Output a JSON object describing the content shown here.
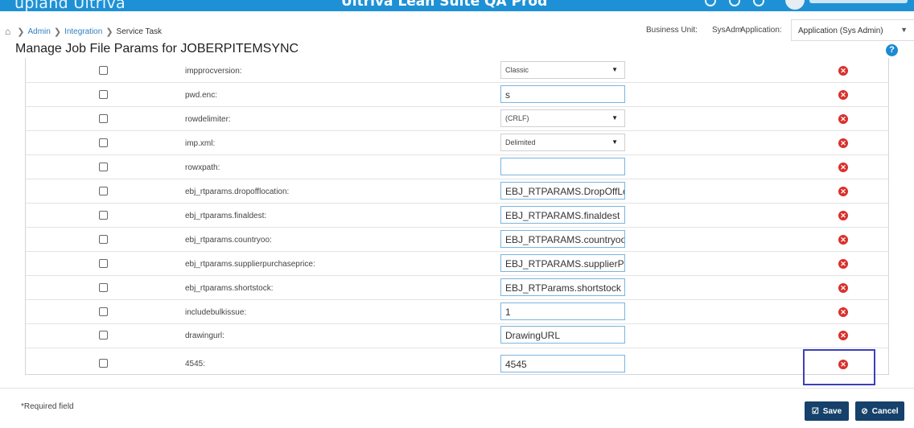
{
  "topbar": {
    "brand": "upland Ultriva",
    "suite": "Ultriva Lean Suite QA Prod"
  },
  "breadcrumb": {
    "items": [
      "Admin",
      "Integration"
    ],
    "current": "Service Task"
  },
  "context": {
    "business_unit_label": "Business Unit:",
    "business_unit_value": "SysAdm",
    "application_label": "Application:",
    "application_value": "Application (Sys Admin)"
  },
  "page": {
    "title": "Manage Job File Params for JOBERPITEMSYNC",
    "help_label": "?"
  },
  "params": [
    {
      "name": "impprocversion:",
      "type": "select",
      "value": "Classic"
    },
    {
      "name": "pwd.enc:",
      "type": "text",
      "value": "s"
    },
    {
      "name": "rowdelimiter:",
      "type": "select",
      "value": "(CRLF)"
    },
    {
      "name": "imp.xml:",
      "type": "select",
      "value": "Delimited"
    },
    {
      "name": "rowxpath:",
      "type": "text",
      "value": ""
    },
    {
      "name": "ebj_rtparams.dropofflocation:",
      "type": "text",
      "value": "EBJ_RTPARAMS.DropOffLoca"
    },
    {
      "name": "ebj_rtparams.finaldest:",
      "type": "text",
      "value": "EBJ_RTPARAMS.finaldest"
    },
    {
      "name": "ebj_rtparams.countryoo:",
      "type": "text",
      "value": "EBJ_RTPARAMS.countryoo"
    },
    {
      "name": "ebj_rtparams.supplierpurchaseprice:",
      "type": "text",
      "value": "EBJ_RTPARAMS.supplierPurc"
    },
    {
      "name": "ebj_rtparams.shortstock:",
      "type": "text",
      "value": "EBJ_RTParams.shortstock"
    },
    {
      "name": "includebulkissue:",
      "type": "text",
      "value": "1"
    },
    {
      "name": "drawingurl:",
      "type": "text",
      "value": "DrawingURL"
    },
    {
      "name": "4545:",
      "type": "text",
      "value": "4545"
    }
  ],
  "footer": {
    "required_note": "*Required field",
    "save_label": "Save",
    "cancel_label": "Cancel"
  },
  "colors": {
    "topbar": "#1e91d6",
    "button": "#15416a",
    "delete": "#d9302b",
    "highlight": "#3d3fb8"
  }
}
